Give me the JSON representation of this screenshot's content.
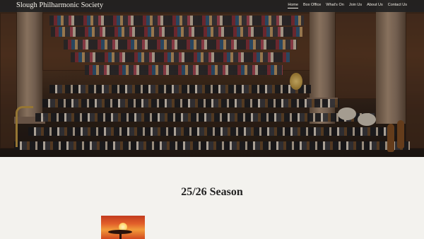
{
  "site": {
    "title": "Slough Philharmonic Society"
  },
  "nav": {
    "items": [
      {
        "label": "Home",
        "active": true
      },
      {
        "label": "Box Office",
        "active": false
      },
      {
        "label": "What's On",
        "active": false
      },
      {
        "label": "Join Us",
        "active": false
      },
      {
        "label": "About Us",
        "active": false
      },
      {
        "label": "Contact Us",
        "active": false
      }
    ]
  },
  "main": {
    "section_title": "25/26 Season"
  },
  "colors": {
    "header_bg": "#222222",
    "page_bg": "#f3f2ee",
    "title_text": "#222222"
  }
}
